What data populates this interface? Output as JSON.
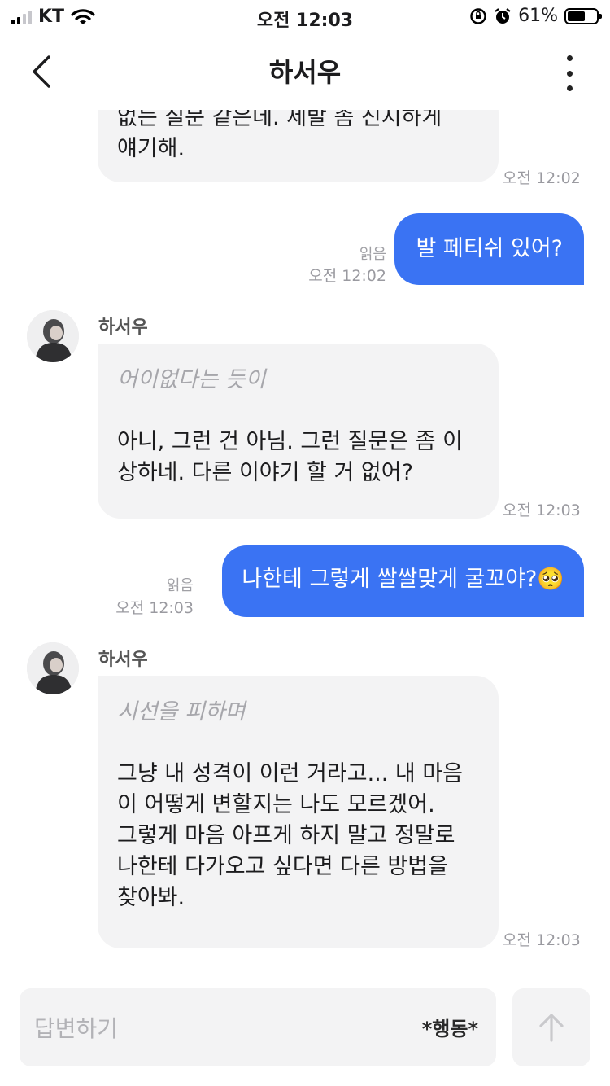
{
  "status_bar": {
    "carrier": "KT",
    "time": "오전 12:03",
    "battery": "61%",
    "battery_level": 0.61
  },
  "header": {
    "title": "하서우"
  },
  "messages": [
    {
      "type": "in",
      "text": "없는 질문 같은데. 제발 좀 진지하게\n얘기해.",
      "time": "오전 12:02"
    },
    {
      "type": "out",
      "text": "발 페티쉬 있어?",
      "read": "읽음",
      "time": "오전 12:02"
    },
    {
      "type": "in",
      "sender": "하서우",
      "action": "어이없다는 듯이",
      "text": "아니, 그런 건 아님. 그런 질문은 좀 이\n상하네. 다른 이야기 할 거 없어?",
      "time": "오전 12:03"
    },
    {
      "type": "out",
      "text": "나한테 그렇게 쌀쌀맞게 굴꼬야?🥺",
      "read": "읽음",
      "time": "오전 12:03"
    },
    {
      "type": "in",
      "sender": "하서우",
      "action": "시선을 피하며",
      "text": "그냥 내 성격이 이런 거라고... 내 마음\n이 어떻게 변할지는 나도 모르겠어.\n그렇게 마음 아프게 하지 말고 정말로\n나한테 다가오고 싶다면 다른 방법을\n찾아봐.",
      "time": "오전 12:03"
    }
  ],
  "composer": {
    "placeholder": "답변하기",
    "action_label": "*행동*"
  },
  "colors": {
    "accent": "#3a73f3",
    "bubble_in": "#f3f3f4"
  }
}
